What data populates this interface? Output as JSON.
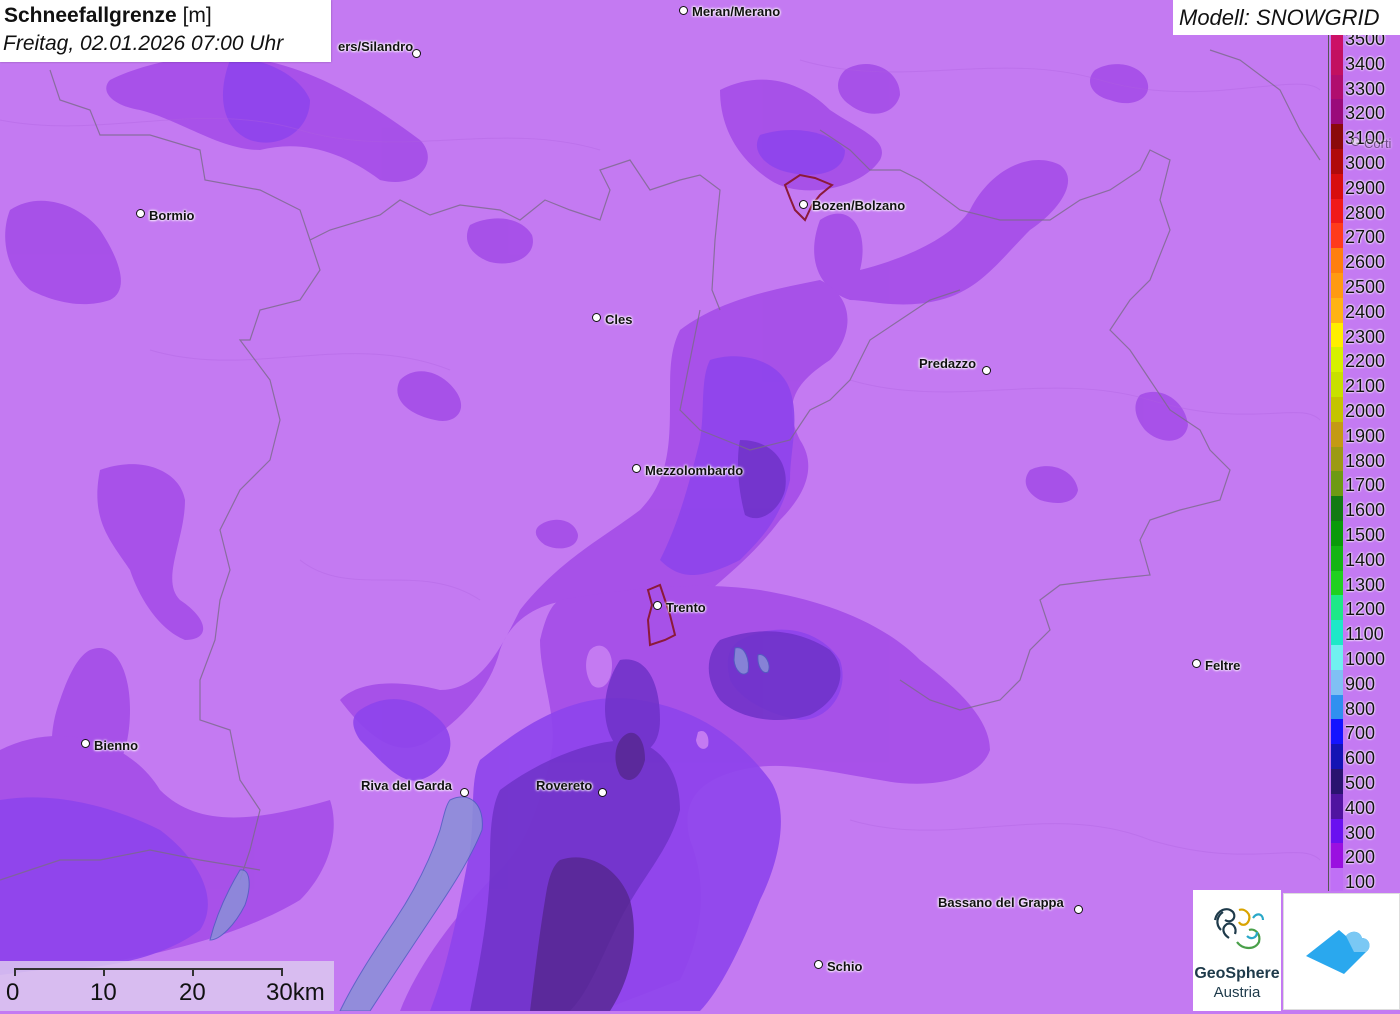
{
  "title": {
    "parameter": "Schneefallgrenze",
    "unit": "[m]",
    "datetime": "Freitag, 02.01.2026 07:00 Uhr"
  },
  "model": {
    "label": "Modell: SNOWGRID"
  },
  "legend": {
    "items": [
      {
        "label": "3500",
        "color": "#cc1166"
      },
      {
        "label": "3400",
        "color": "#c21060"
      },
      {
        "label": "3300",
        "color": "#b00e6e"
      },
      {
        "label": "3200",
        "color": "#9a0b7a"
      },
      {
        "label": "3100",
        "color": "#8b0a0a"
      },
      {
        "label": "3000",
        "color": "#b00a0a"
      },
      {
        "label": "2900",
        "color": "#d80e0e"
      },
      {
        "label": "2800",
        "color": "#f01a1a"
      },
      {
        "label": "2700",
        "color": "#ff3b1c"
      },
      {
        "label": "2600",
        "color": "#ff7f0e"
      },
      {
        "label": "2500",
        "color": "#ff9a12"
      },
      {
        "label": "2400",
        "color": "#ffb314"
      },
      {
        "label": "2300",
        "color": "#ffee00"
      },
      {
        "label": "2200",
        "color": "#d6f000"
      },
      {
        "label": "2100",
        "color": "#c8e000"
      },
      {
        "label": "2000",
        "color": "#c4c400"
      },
      {
        "label": "1900",
        "color": "#c49a14"
      },
      {
        "label": "1800",
        "color": "#9c9a14"
      },
      {
        "label": "1700",
        "color": "#6e9a14"
      },
      {
        "label": "1600",
        "color": "#137a14"
      },
      {
        "label": "1500",
        "color": "#0a9a0a"
      },
      {
        "label": "1400",
        "color": "#14b414"
      },
      {
        "label": "1300",
        "color": "#20d020"
      },
      {
        "label": "1200",
        "color": "#1ee888"
      },
      {
        "label": "1100",
        "color": "#1ee8c8"
      },
      {
        "label": "1000",
        "color": "#70f0f0"
      },
      {
        "label": "900",
        "color": "#80c0f4"
      },
      {
        "label": "800",
        "color": "#3090f0"
      },
      {
        "label": "700",
        "color": "#1414ff"
      },
      {
        "label": "600",
        "color": "#1414b4"
      },
      {
        "label": "500",
        "color": "#2a1470"
      },
      {
        "label": "400",
        "color": "#5014a0"
      },
      {
        "label": "300",
        "color": "#6a10f0"
      },
      {
        "label": "200",
        "color": "#9a10e0"
      },
      {
        "label": "100",
        "color": "#c070f6"
      }
    ]
  },
  "cities": [
    {
      "name": "Meran/Merano"
    },
    {
      "name": "ers/Silandro"
    },
    {
      "name": "Bozen/Bolzano"
    },
    {
      "name": "Bormio"
    },
    {
      "name": "Cles"
    },
    {
      "name": "Predazzo"
    },
    {
      "name": "Mezzolombardo"
    },
    {
      "name": "Trento"
    },
    {
      "name": "Feltre"
    },
    {
      "name": "Bienno"
    },
    {
      "name": "Riva del Garda"
    },
    {
      "name": "Rovereto"
    },
    {
      "name": "Bassano del Grappa"
    },
    {
      "name": "Schio"
    },
    {
      "name": "Corti"
    }
  ],
  "scale": {
    "labels": [
      "0",
      "10",
      "20",
      "30km"
    ]
  },
  "logos": {
    "geosphere_name": "GeoSphere",
    "geosphere_sub": "Austria"
  },
  "colors": {
    "background": "#c47af2",
    "zone_200": "#a24ce6",
    "zone_300": "#8a3ee8",
    "zone_400": "#6f32c8",
    "zone_500": "#5a2a9a",
    "app_icon": "#2aa8ee"
  }
}
